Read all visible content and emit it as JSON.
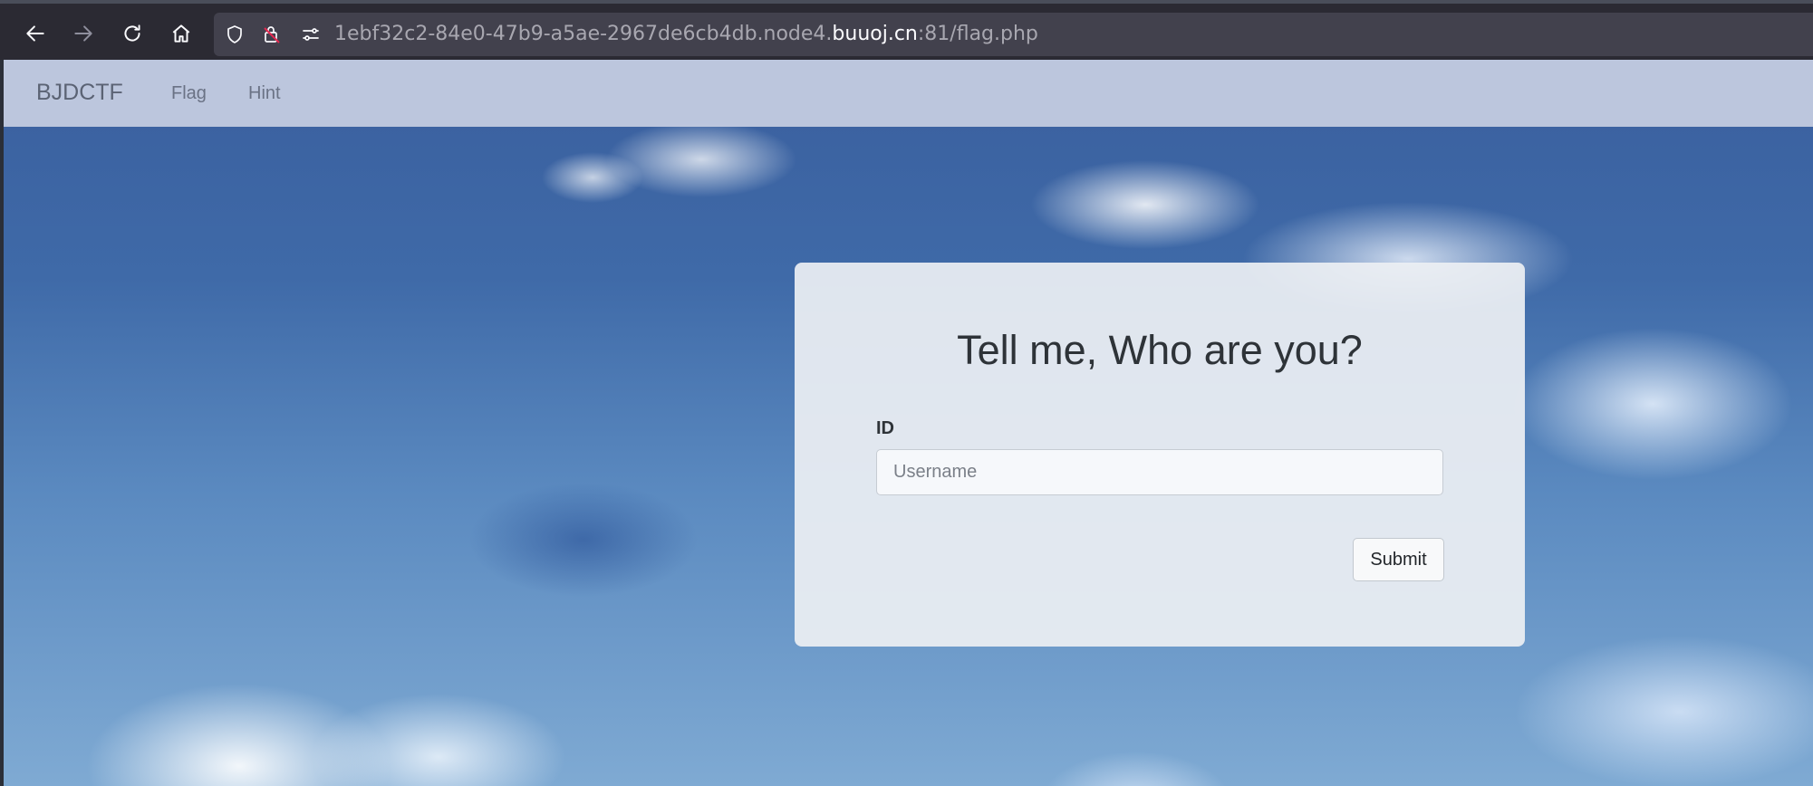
{
  "browser": {
    "url_prefix": "1ebf32c2-84e0-47b9-a5ae-2967de6cb4db.node4.",
    "url_domain": "buuoj.cn",
    "url_suffix": ":81/flag.php",
    "icons": [
      "back-arrow-icon",
      "forward-arrow-icon",
      "reload-icon",
      "home-icon",
      "shield-icon",
      "insecure-lock-icon",
      "permissions-icon"
    ]
  },
  "navbar": {
    "brand": "BJDCTF",
    "links": [
      {
        "label": "Flag"
      },
      {
        "label": "Hint"
      }
    ]
  },
  "form": {
    "title": "Tell me, Who are you?",
    "id_label": "ID",
    "username_placeholder": "Username",
    "username_value": "",
    "submit_label": "Submit"
  },
  "colors": {
    "sky_top": "#3a5f9e",
    "sky_bottom": "#7faad3",
    "navbar_bg": "#c6cee2",
    "card_bg": "#eceff3"
  }
}
